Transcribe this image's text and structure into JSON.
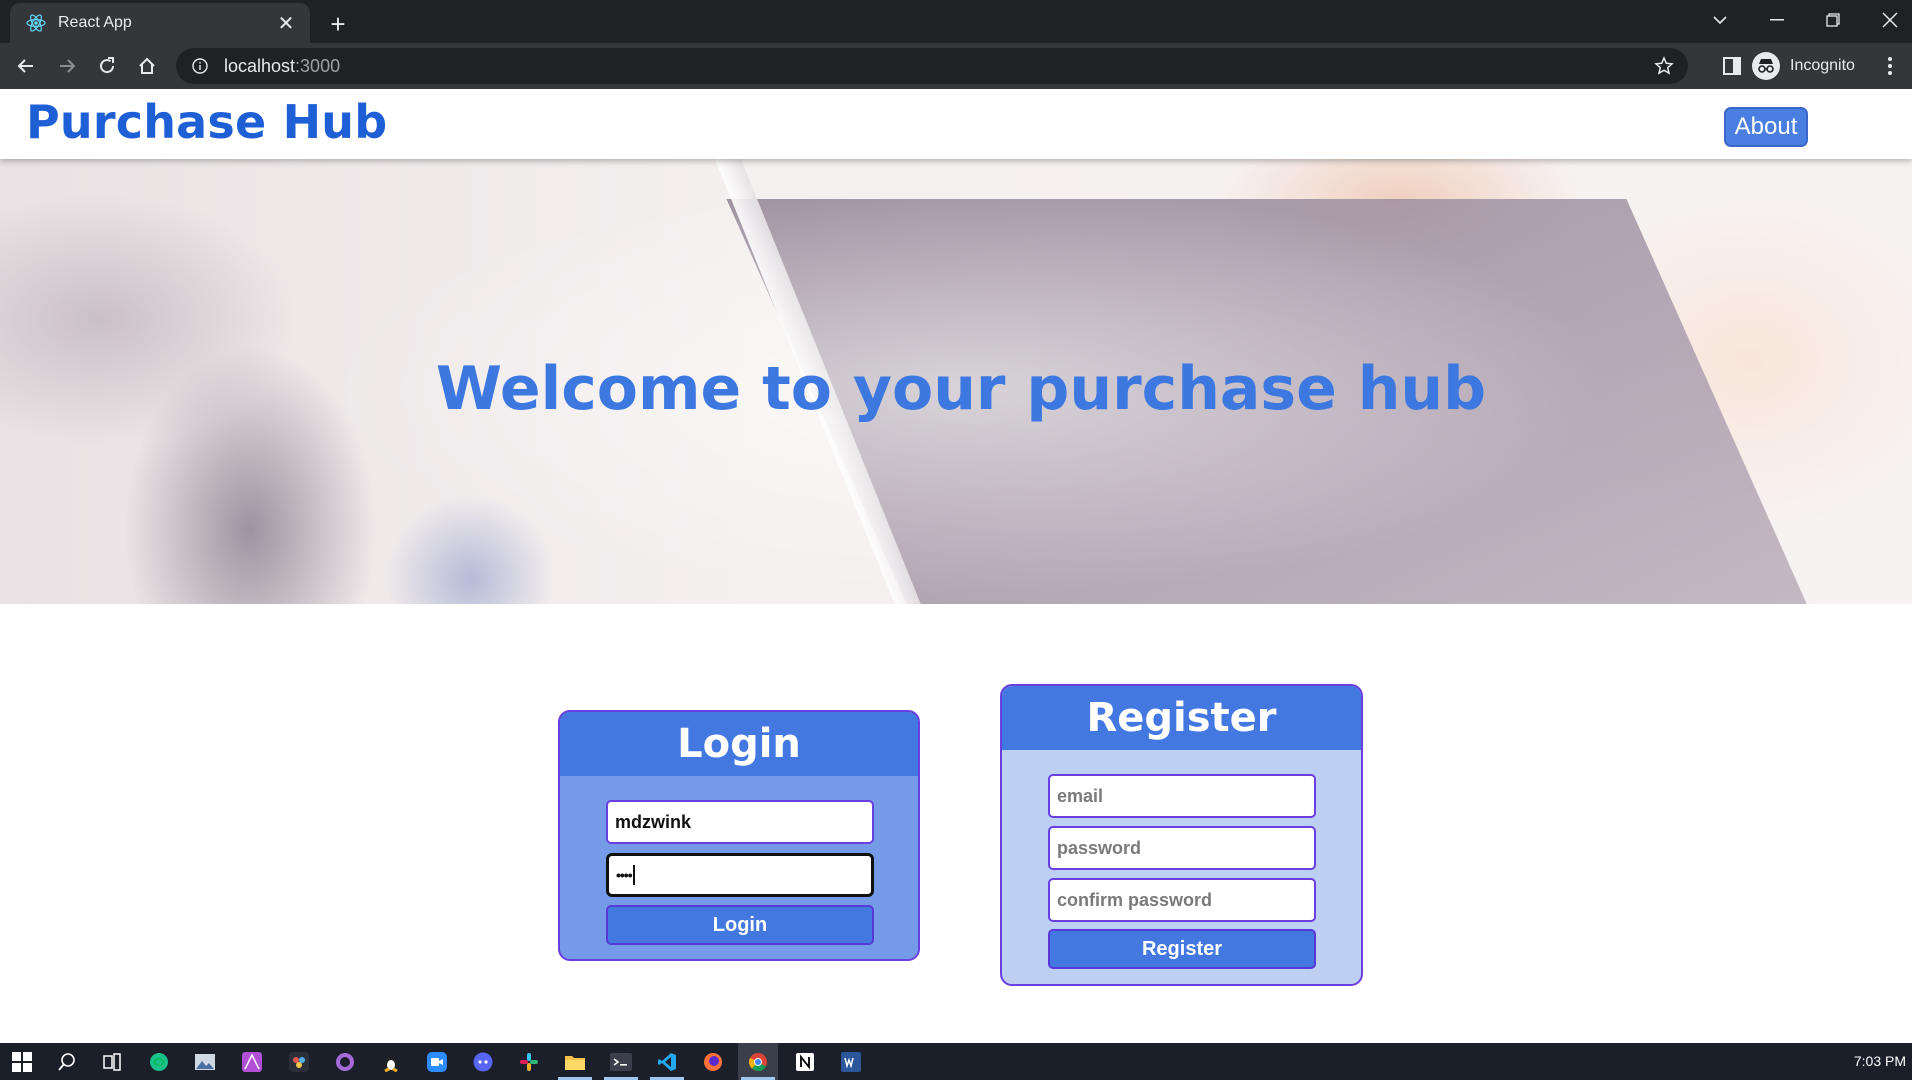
{
  "browser": {
    "tab_title": "React App",
    "address_host": "localhost",
    "address_port": ":3000",
    "profile_label": "Incognito"
  },
  "app": {
    "brand": "Purchase Hub",
    "nav_about": "About",
    "hero_title": "Welcome to your purchase hub"
  },
  "login": {
    "title": "Login",
    "username_value": "mdzwink",
    "password_mask": "••••",
    "submit_label": "Login"
  },
  "register": {
    "title": "Register",
    "email_placeholder": "email",
    "password_placeholder": "password",
    "confirm_placeholder": "confirm password",
    "submit_label": "Register"
  },
  "taskbar": {
    "time": "7:03 PM",
    "icons": [
      "windows-start-icon",
      "search-icon",
      "task-view-icon",
      "app-green-icon",
      "photos-icon",
      "affinity-icon",
      "davinci-icon",
      "github-icon",
      "linux-icon",
      "zoom-icon",
      "discord-icon",
      "slack-icon",
      "file-explorer-icon",
      "terminal-icon",
      "vscode-icon",
      "firefox-icon",
      "chrome-icon",
      "notion-icon",
      "word-icon"
    ]
  },
  "colors": {
    "brand_blue": "#1f5fd6",
    "hero_blue": "#3c78e0",
    "card_header": "#4378e0",
    "login_body": "#759be8",
    "register_body": "#bdcff3",
    "card_border": "#6a3fe0"
  }
}
